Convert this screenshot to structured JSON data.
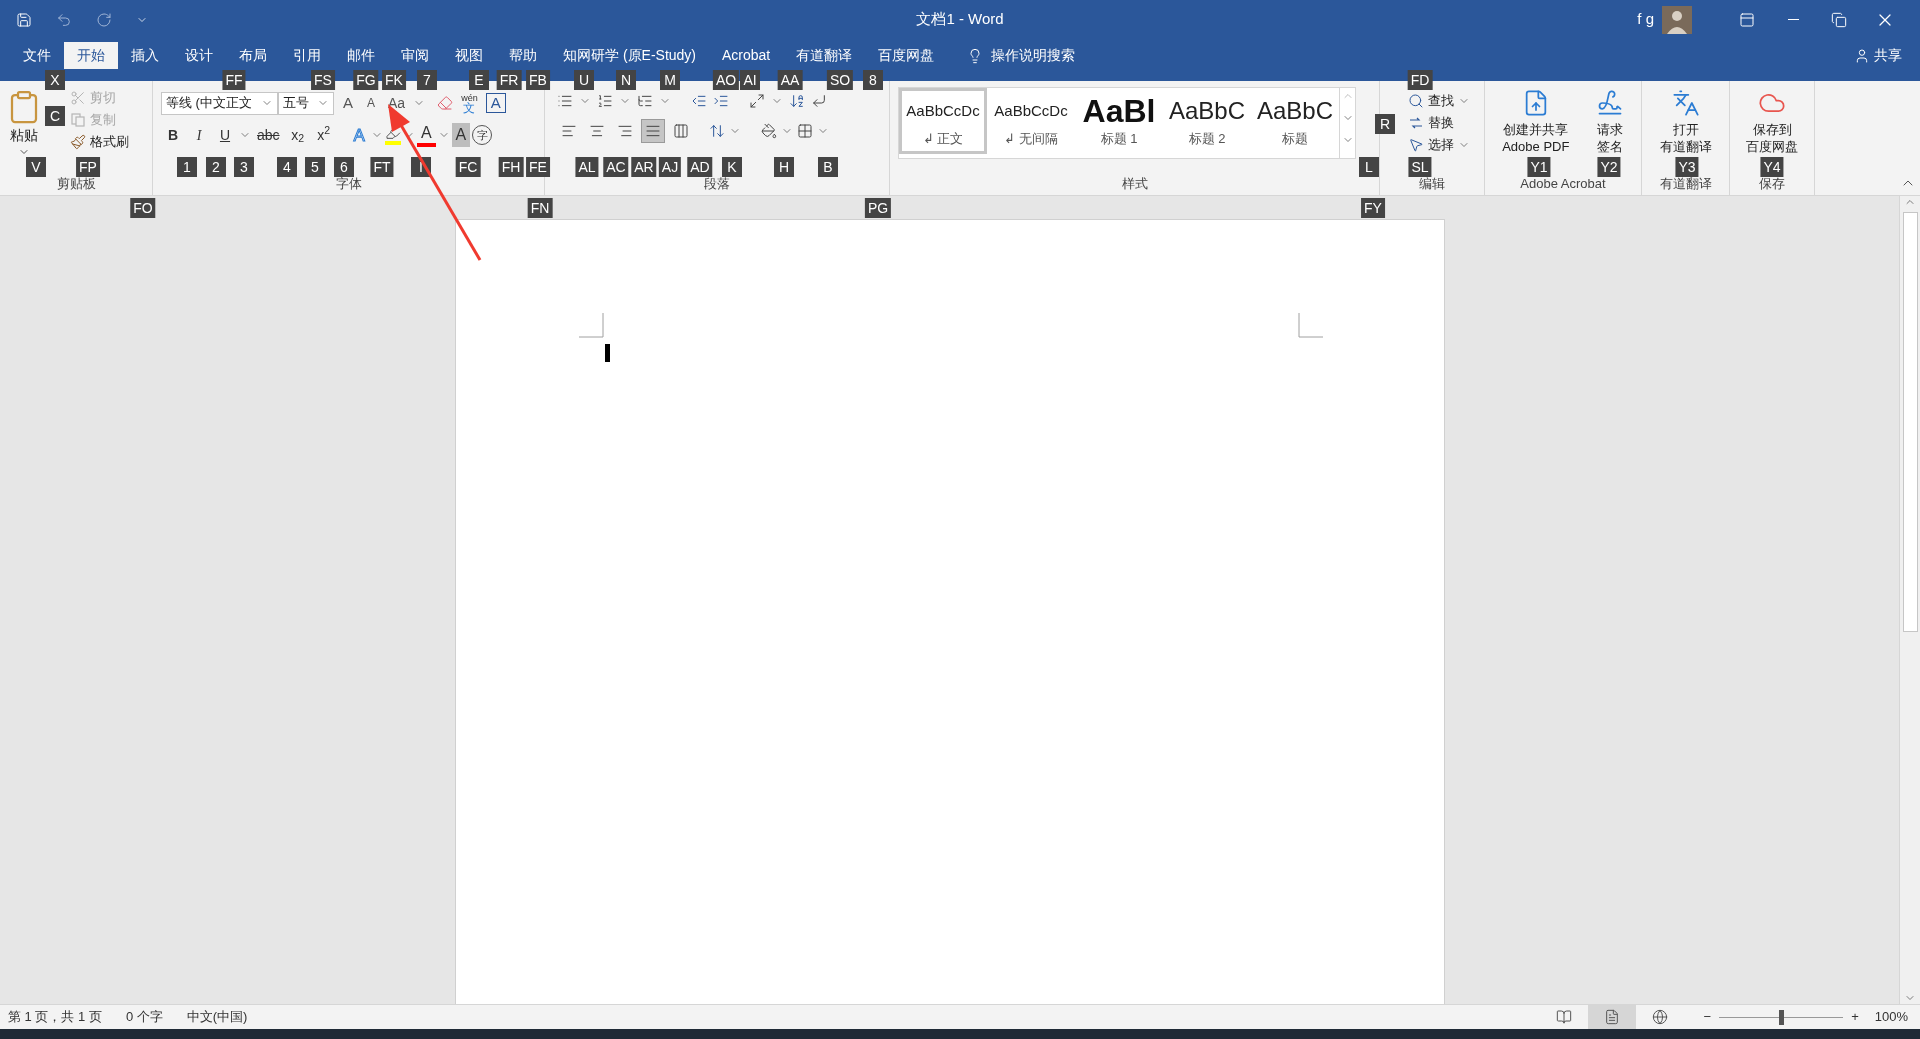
{
  "title_bar": {
    "title": "文档1 - Word",
    "user": "f g"
  },
  "menu_tabs": [
    {
      "label": "文件",
      "selected": false
    },
    {
      "label": "开始",
      "selected": true
    },
    {
      "label": "插入",
      "selected": false
    },
    {
      "label": "设计",
      "selected": false
    },
    {
      "label": "布局",
      "selected": false
    },
    {
      "label": "引用",
      "selected": false
    },
    {
      "label": "邮件",
      "selected": false
    },
    {
      "label": "审阅",
      "selected": false
    },
    {
      "label": "视图",
      "selected": false
    },
    {
      "label": "帮助",
      "selected": false
    },
    {
      "label": "知网研学 (原E-Study)",
      "selected": false
    },
    {
      "label": "Acrobat",
      "selected": false
    },
    {
      "label": "有道翻译",
      "selected": false
    },
    {
      "label": "百度网盘",
      "selected": false
    }
  ],
  "tell_me": "操作说明搜索",
  "share": "共享",
  "clipboard": {
    "label": "剪贴板",
    "paste": "粘贴",
    "small_buttons": [
      {
        "kind": "cut",
        "label": "剪切",
        "disabled": true
      },
      {
        "kind": "copy",
        "label": "复制",
        "disabled": true
      },
      {
        "kind": "painter",
        "label": "格式刷",
        "disabled": false
      }
    ]
  },
  "font": {
    "label": "字体",
    "font_name": "等线 (中文正文",
    "font_size": "五号",
    "size_buttons": [
      {
        "kind": "grow",
        "glyph": "A"
      },
      {
        "kind": "shrink",
        "glyph": "A"
      }
    ],
    "case_button": "Aa",
    "pinyin": {
      "ruby": "wén",
      "glyph": "文"
    },
    "border_glyph": "A",
    "format_buttons": [
      {
        "glyph": "B",
        "kind": "bold"
      },
      {
        "glyph": "I",
        "kind": "italic"
      },
      {
        "glyph": "U",
        "kind": "underline"
      },
      {
        "glyph": "abc",
        "kind": "strike"
      },
      {
        "glyph": "x$_{2}$",
        "kind": "plain"
      },
      {
        "glyph": "x$^{2}$",
        "kind": "plain"
      }
    ],
    "color_buttons": [
      {
        "kind": "effect",
        "glyph": "A"
      },
      {
        "kind": "highlight"
      },
      {
        "kind": "font_color",
        "glyph": "A"
      },
      {
        "kind": "shading",
        "glyph": "A"
      },
      {
        "kind": "enclosed",
        "glyph": "字"
      }
    ]
  },
  "paragraph": {
    "label": "段落",
    "align_buttons": [
      {
        "kind": "left",
        "selected": false
      },
      {
        "kind": "center",
        "selected": false
      },
      {
        "kind": "right",
        "selected": false
      },
      {
        "kind": "justify",
        "selected": true
      },
      {
        "kind": "distributed",
        "selected": false
      }
    ]
  },
  "styles": {
    "label": "样式",
    "items": [
      {
        "preview": "AaBbCcDc",
        "name": "↲ 正文",
        "kind": "normal",
        "selected": true
      },
      {
        "preview": "AaBbCcDc",
        "name": "↲ 无间隔",
        "kind": "normal",
        "selected": false
      },
      {
        "preview": "AaBl",
        "name": "标题 1",
        "kind": "heading1",
        "selected": false
      },
      {
        "preview": "AaBbC",
        "name": "标题 2",
        "kind": "heading2",
        "selected": false
      },
      {
        "preview": "AaBbC",
        "name": "标题",
        "kind": "title",
        "selected": false
      }
    ]
  },
  "editing": {
    "label": "编辑",
    "items": [
      {
        "kind": "find",
        "label": "查找",
        "dropdown": true
      },
      {
        "kind": "replace",
        "label": "替换",
        "dropdown": false
      },
      {
        "kind": "select",
        "label": "选择",
        "dropdown": true
      }
    ]
  },
  "addin_groups": [
    {
      "label": "Adobe Acrobat",
      "buttons": [
        {
          "kind": "pdf",
          "lines": [
            "创建并共享",
            "Adobe PDF"
          ]
        },
        {
          "kind": "sign",
          "lines": [
            "请求",
            "签名"
          ]
        }
      ]
    },
    {
      "label": "有道翻译",
      "buttons": [
        {
          "kind": "translate",
          "lines": [
            "打开",
            "有道翻译"
          ]
        }
      ]
    },
    {
      "label": "保存",
      "buttons": [
        {
          "kind": "cloud",
          "lines": [
            "保存到",
            "百度网盘"
          ]
        }
      ]
    }
  ],
  "keytips": [
    "X",
    "FF",
    "FS",
    "FG",
    "FK",
    "7",
    "E",
    "FR",
    "FB",
    "U",
    "N",
    "M",
    "AO",
    "AI",
    "AA",
    "SO",
    "8",
    "FD",
    "C",
    "R",
    "V",
    "FP",
    "1",
    "2",
    "3",
    "4",
    "5",
    "6",
    "FT",
    "I",
    "FC",
    "FH",
    "FE",
    "AL",
    "AC",
    "AR",
    "AJ",
    "AD",
    "K",
    "H",
    "B",
    "L",
    "SL",
    "Y1",
    "Y2",
    "Y3",
    "Y4",
    "FO",
    "FN",
    "PG",
    "FY"
  ],
  "status_bar": {
    "page": "第 1 页，共 1 页",
    "words": "0 个字",
    "language": "中文(中国)",
    "view_buttons": [
      {
        "kind": "read",
        "selected": false
      },
      {
        "kind": "print",
        "selected": true
      },
      {
        "kind": "web",
        "selected": false
      }
    ],
    "zoom": {
      "minus": "−",
      "plus": "+",
      "level": 0.5,
      "reading": "100%"
    }
  }
}
